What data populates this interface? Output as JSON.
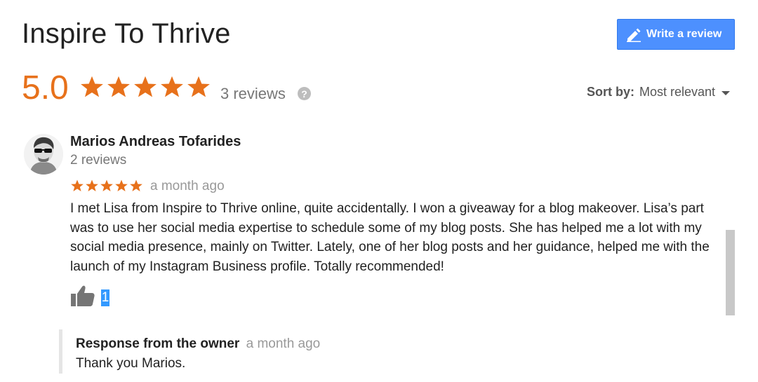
{
  "header": {
    "title": "Inspire To Thrive",
    "write_review_label": "Write a review"
  },
  "rating": {
    "score": "5.0",
    "stars": 5,
    "review_count": "3 reviews",
    "help_icon": "?"
  },
  "sort": {
    "label": "Sort by:",
    "value": "Most relevant"
  },
  "review": {
    "author": "Marios Andreas Tofarides",
    "author_reviews": "2 reviews",
    "stars": 5,
    "date": "a month ago",
    "text": "I met Lisa from Inspire to Thrive online, quite accidentally. I won a giveaway for a blog makeover. Lisa’s part was to use her social media expertise to schedule some of my blog posts. She has helped me a lot with my social media presence, mainly on Twitter. Lately, one of her blog posts and her guidance, helped me with the launch of my Instagram Business profile. Totally recommended!",
    "likes": "1"
  },
  "response": {
    "label": "Response from the owner",
    "date": "a month ago",
    "text": "Thank you Marios."
  },
  "colors": {
    "accent": "#e7711b",
    "button": "#4d90fe",
    "selection": "#3399ff"
  },
  "icons": {
    "edit": "pencil-icon",
    "help": "question-icon",
    "like": "thumbs-up-icon",
    "sort": "caret-down-icon"
  }
}
